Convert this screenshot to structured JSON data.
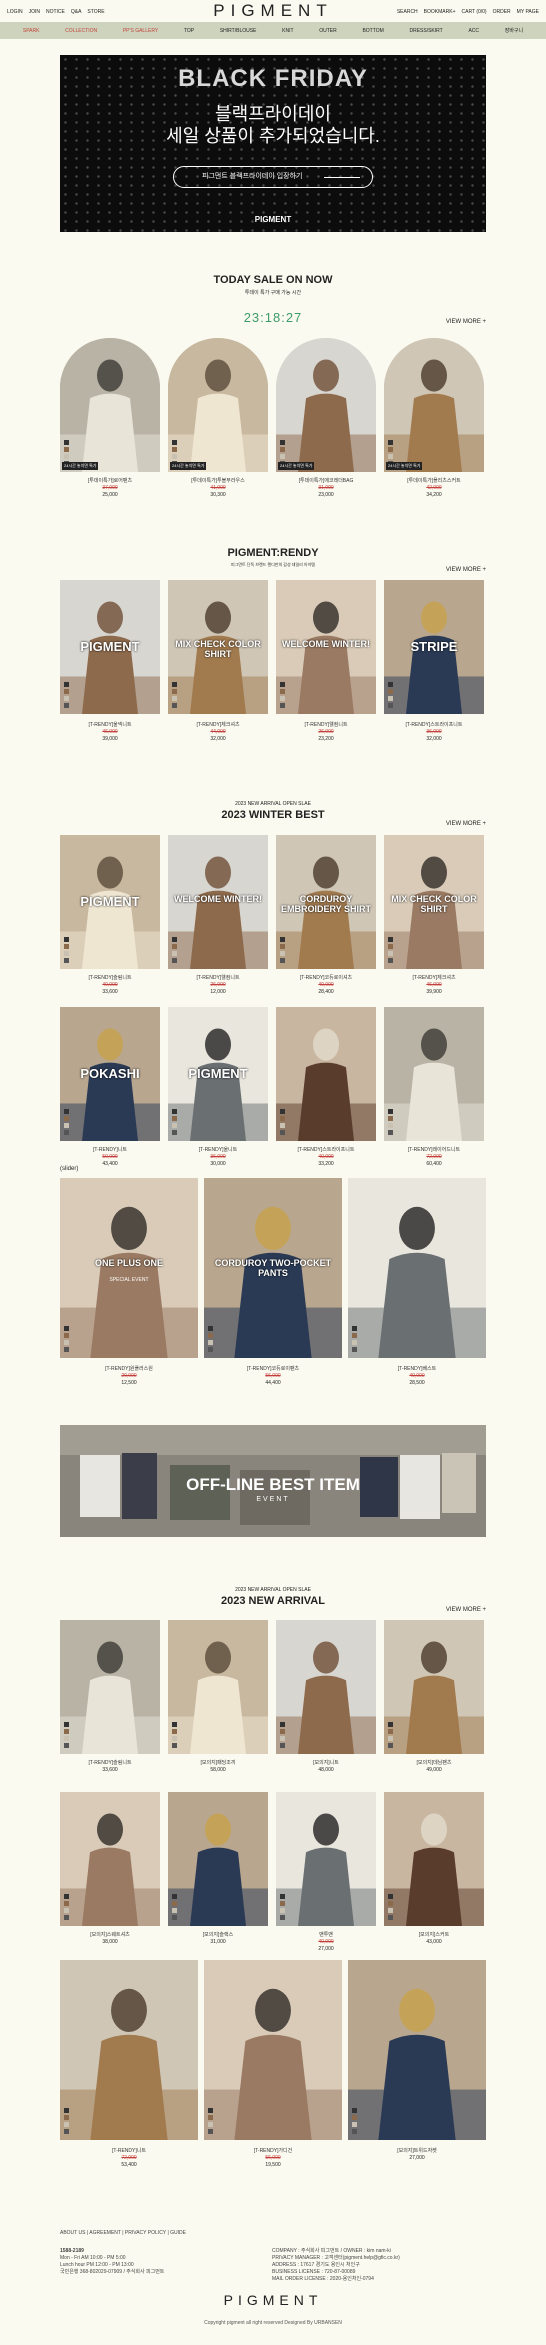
{
  "topbar": {
    "left": [
      "LOGIN",
      "JOIN",
      "NOTICE",
      "Q&A",
      "STORE"
    ],
    "right": [
      "SEARCH",
      "BOOKMARK+",
      "CART (0/0)",
      "ORDER",
      "MY PAGE"
    ]
  },
  "logo": "PIGMENT",
  "categories": [
    {
      "label": "SPARK",
      "red": true
    },
    {
      "label": "COLLECTION",
      "red": true
    },
    {
      "label": "PP'S GALLERY",
      "red": true
    },
    {
      "label": "TOP",
      "red": false
    },
    {
      "label": "SHIRT/BLOUSE",
      "red": false
    },
    {
      "label": "KNIT",
      "red": false
    },
    {
      "label": "OUTER",
      "red": false
    },
    {
      "label": "BOTTOM",
      "red": false
    },
    {
      "label": "DRESS/SKIRT",
      "red": false
    },
    {
      "label": "ACC",
      "red": false
    },
    {
      "label": "장바구니",
      "red": false
    }
  ],
  "hero": {
    "title": "BLACK FRIDAY",
    "line1": "블랙프라이데이",
    "line2": "세일 상품이 추가되었습니다.",
    "cta": "피그먼트 블랙프라이데이 입장하기",
    "brand": "PIGMENT"
  },
  "today": {
    "title": "TODAY SALE ON NOW",
    "subtitle": "투데이 특가 구매 가능 시간",
    "timer": "23:18:27",
    "viewmore": "VIEW MORE +",
    "badge": "24시간 놓치면 특가",
    "items": [
      {
        "name": "[투데이특가]로어팬츠",
        "old": "37,000",
        "price": "25,000"
      },
      {
        "name": "[투데이특가]투볼부라우스",
        "old": "41,000",
        "price": "30,300"
      },
      {
        "name": "[투데이특가]에코레더BAG",
        "old": "31,000",
        "price": "23,000"
      },
      {
        "name": "[투데이특가]플리츠스커트",
        "old": "42,000",
        "price": "34,200"
      }
    ]
  },
  "rendy": {
    "title": "PIGMENT:RENDY",
    "subtitle": "피그먼트 단독 브랜드 렌디만의 감성 데일리 아이템",
    "viewmore": "VIEW MORE +",
    "items": [
      {
        "name": "[T-RENDY]울넥니트",
        "old": "46,000",
        "price": "39,000",
        "overlay": "PIGMENT"
      },
      {
        "name": "[T-RENDY]체크셔츠",
        "old": "44,000",
        "price": "32,000",
        "overlay": "MIX CHECK COLOR SHIRT"
      },
      {
        "name": "[T-RENDY]웰컴니트",
        "old": "26,000",
        "price": "23,200",
        "overlay": "WELCOME WINTER!"
      },
      {
        "name": "[T-RENDY]스트라이프니트",
        "old": "36,000",
        "price": "32,000",
        "overlay": "STRIPE"
      }
    ]
  },
  "winter": {
    "small": "2023 NEW ARRIVAL OPEN SLAE",
    "title": "2023 WINTER BEST",
    "viewmore": "VIEW MORE +",
    "items": [
      {
        "name": "[T-RENDY]슬림니트",
        "old": "40,000",
        "price": "33,600",
        "overlay": "PIGMENT"
      },
      {
        "name": "[T-RENDY]웰컴니트",
        "old": "26,000",
        "price": "12,000",
        "overlay": "WELCOME WINTER!"
      },
      {
        "name": "[T-RENDY]코듀로이셔츠",
        "old": "40,000",
        "price": "28,400",
        "overlay": "CORDUROY EMBROIDERY SHIRT"
      },
      {
        "name": "[T-RENDY]체크셔츠",
        "old": "46,000",
        "price": "39,900",
        "overlay": "MIX CHECK COLOR SHIRT"
      },
      {
        "name": "[T-RENDY]니트",
        "old": "50,000",
        "price": "43,400",
        "overlay": "POKASHI"
      },
      {
        "name": "[T-RENDY]울니트",
        "old": "36,000",
        "price": "30,000",
        "overlay": "PIGMENT"
      },
      {
        "name": "[T-RENDY]스트라이프니트",
        "old": "40,000",
        "price": "33,200",
        "overlay": ""
      },
      {
        "name": "[T-RENDY]레이어드니트",
        "old": "72,000",
        "price": "60,400",
        "overlay": ""
      }
    ],
    "slider": "(slider)",
    "big": [
      {
        "name": "[T-RENDY]원플러스원",
        "old": "20,000",
        "price": "12,500",
        "overlay": "ONE PLUS ONE",
        "sub": "SPECIAL EVENT"
      },
      {
        "name": "[T-RENDY]코듀로이팬츠",
        "old": "56,000",
        "price": "44,400",
        "overlay": "CORDUROY TWO-POCKET PANTS",
        "sub": ""
      },
      {
        "name": "[T-RENDY]베스트",
        "old": "40,000",
        "price": "28,500",
        "overlay": "",
        "sub": ""
      }
    ]
  },
  "offline": {
    "title": "OFF-LINE BEST ITEM",
    "sub": "EVENT"
  },
  "arrival": {
    "small": "2023 NEW ARRIVAL OPEN SLAE",
    "title": "2023 NEW ARRIVAL",
    "viewmore": "VIEW MORE +",
    "items": [
      {
        "name": "[T-RENDY]슬림니트",
        "old": "",
        "price": "33,600"
      },
      {
        "name": "[모의지]패딩조끼",
        "old": "",
        "price": "58,000"
      },
      {
        "name": "[모의지]니트",
        "old": "",
        "price": "48,000"
      },
      {
        "name": "[모의지]데님팬츠",
        "old": "",
        "price": "49,000"
      },
      {
        "name": "[모의지]스웨트셔츠",
        "old": "",
        "price": "38,000"
      },
      {
        "name": "[모의지]슬랙스",
        "old": "",
        "price": "31,000"
      },
      {
        "name": "맨투맨",
        "old": "40,000",
        "price": "27,000"
      },
      {
        "name": "[모의지]스커트",
        "old": "",
        "price": "43,000"
      }
    ],
    "big": [
      {
        "name": "[T-RENDY]니트",
        "old": "72,000",
        "price": "53,400"
      },
      {
        "name": "[T-RENDY]가디건",
        "old": "56,000",
        "price": "19,500"
      },
      {
        "name": "[모의지]트위드자켓",
        "old": "",
        "price": "27,000"
      }
    ]
  },
  "footer": {
    "links": "ABOUT US  |  AGREEMENT  |  PRIVACY POLICY  |  GUIDE",
    "phone": "1588-2189",
    "hours1": "Mon - Fri AM 10:00 - PM 5:00",
    "hours2": "Lunch hour PM 12:00 - PM 13:00",
    "bank": "국민은행 368-802029-07909 / 주식회사 피그먼트",
    "c1": "COMPANY : 주식회사 피그먼트  /  OWNER : kim nam-ki",
    "c2": "PRIVACY MANAGER : 고객센터(pigment.help@gfic.co.kr)",
    "c3": "ADDRESS : 17617 경기도 용인시 처인구",
    "c4": "BUSINESS LICENSE : 720-87-00089",
    "c5": "MAIL ORDER LICENSE : 2020-용인처인-0794"
  },
  "footer_logo": "PIGMENT",
  "copyright": "Copyright pigment all right reserved Designed By URBANSEN"
}
